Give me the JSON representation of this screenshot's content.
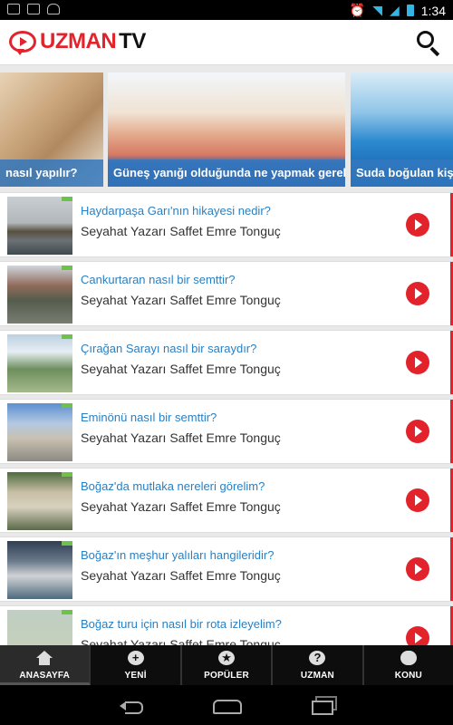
{
  "status_bar": {
    "time": "1:34",
    "left_icons": [
      "image-icon",
      "email-icon",
      "android-icon"
    ],
    "right_icons": [
      "alarm-icon",
      "wifi-icon",
      "signal-icon",
      "battery-icon"
    ]
  },
  "app": {
    "logo_uzman": "UZMAN",
    "logo_tv": "TV",
    "brand_color": "#e3232b",
    "accent_text_color": "#2a7fc1"
  },
  "carousel": [
    {
      "caption": "nasıl yapılır?"
    },
    {
      "caption": "Güneş yanığı olduğunda ne yapmak gerekir?"
    },
    {
      "caption": "Suda boğulan kişi na"
    }
  ],
  "videos": [
    {
      "title": "Haydarpaşa Garı'nın hikayesi nedir?",
      "author": "Seyahat Yazarı Saffet Emre Tonguç"
    },
    {
      "title": "Cankurtaran nasıl bir semttir?",
      "author": "Seyahat Yazarı Saffet Emre Tonguç"
    },
    {
      "title": "Çırağan Sarayı nasıl bir saraydır?",
      "author": "Seyahat Yazarı Saffet Emre Tonguç"
    },
    {
      "title": "Eminönü nasıl bir semttir?",
      "author": "Seyahat Yazarı Saffet Emre Tonguç"
    },
    {
      "title": "Boğaz'da mutlaka nereleri görelim?",
      "author": "Seyahat Yazarı Saffet Emre Tonguç"
    },
    {
      "title": "Boğaz'ın meşhur yalıları hangileridir?",
      "author": "Seyahat Yazarı Saffet Emre Tonguç"
    },
    {
      "title": "Boğaz turu için nasıl bir rota izleyelim?",
      "author": "Seyahat Yazarı Saffet Emre Tonguç"
    }
  ],
  "tabs": [
    {
      "label": "ANASAYFA",
      "icon": "home-icon",
      "active": true
    },
    {
      "label": "YENİ",
      "icon": "plus-icon",
      "active": false
    },
    {
      "label": "POPÜLER",
      "icon": "star-icon",
      "active": false
    },
    {
      "label": "UZMAN",
      "icon": "question-icon",
      "active": false
    },
    {
      "label": "KONU",
      "icon": "chat-icon",
      "active": false
    }
  ],
  "nav_icons": [
    "back-icon",
    "home-icon",
    "recent-apps-icon"
  ]
}
